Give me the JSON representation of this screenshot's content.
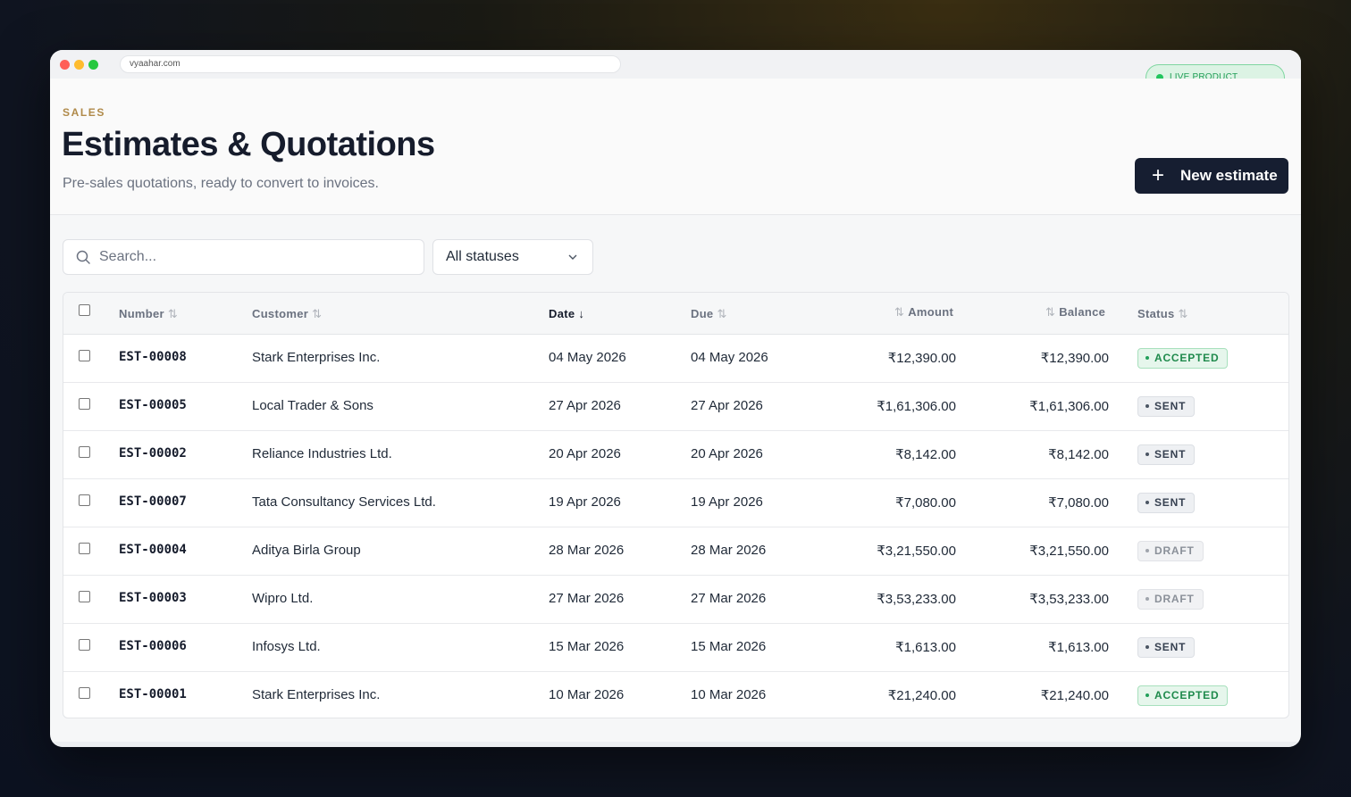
{
  "browser": {
    "url": "vyaahar.com"
  },
  "live_badge": "LIVE PRODUCT",
  "header": {
    "eyebrow": "SALES",
    "title": "Estimates & Quotations",
    "subtitle": "Pre-sales quotations, ready to convert to invoices.",
    "new_button": "New estimate"
  },
  "filters": {
    "search_placeholder": "Search...",
    "status_selected": "All statuses"
  },
  "table": {
    "columns": {
      "number": "Number",
      "customer": "Customer",
      "date": "Date",
      "due": "Due",
      "amount": "Amount",
      "balance": "Balance",
      "status": "Status"
    },
    "rows": [
      {
        "number": "EST-00008",
        "customer": "Stark Enterprises Inc.",
        "date": "04 May 2026",
        "due": "04 May 2026",
        "amount": "₹12,390.00",
        "balance": "₹12,390.00",
        "status": "ACCEPTED"
      },
      {
        "number": "EST-00005",
        "customer": "Local Trader & Sons",
        "date": "27 Apr 2026",
        "due": "27 Apr 2026",
        "amount": "₹1,61,306.00",
        "balance": "₹1,61,306.00",
        "status": "SENT"
      },
      {
        "number": "EST-00002",
        "customer": "Reliance Industries Ltd.",
        "date": "20 Apr 2026",
        "due": "20 Apr 2026",
        "amount": "₹8,142.00",
        "balance": "₹8,142.00",
        "status": "SENT"
      },
      {
        "number": "EST-00007",
        "customer": "Tata Consultancy Services Ltd.",
        "date": "19 Apr 2026",
        "due": "19 Apr 2026",
        "amount": "₹7,080.00",
        "balance": "₹7,080.00",
        "status": "SENT"
      },
      {
        "number": "EST-00004",
        "customer": "Aditya Birla Group",
        "date": "28 Mar 2026",
        "due": "28 Mar 2026",
        "amount": "₹3,21,550.00",
        "balance": "₹3,21,550.00",
        "status": "DRAFT"
      },
      {
        "number": "EST-00003",
        "customer": "Wipro Ltd.",
        "date": "27 Mar 2026",
        "due": "27 Mar 2026",
        "amount": "₹3,53,233.00",
        "balance": "₹3,53,233.00",
        "status": "DRAFT"
      },
      {
        "number": "EST-00006",
        "customer": "Infosys Ltd.",
        "date": "15 Mar 2026",
        "due": "15 Mar 2026",
        "amount": "₹1,613.00",
        "balance": "₹1,613.00",
        "status": "SENT"
      },
      {
        "number": "EST-00001",
        "customer": "Stark Enterprises Inc.",
        "date": "10 Mar 2026",
        "due": "10 Mar 2026",
        "amount": "₹21,240.00",
        "balance": "₹21,240.00",
        "status": "ACCEPTED"
      }
    ]
  },
  "icons": {
    "search": "search-icon",
    "chevron": "chevron-down-icon",
    "plus": "plus-icon",
    "sort": "sort-icon",
    "sort_desc": "arrow-down-icon"
  },
  "colors": {
    "primary_button": "#161e31",
    "eyebrow": "#b08a4a",
    "accepted": "#1f8a4c",
    "live": "#22c55e"
  }
}
